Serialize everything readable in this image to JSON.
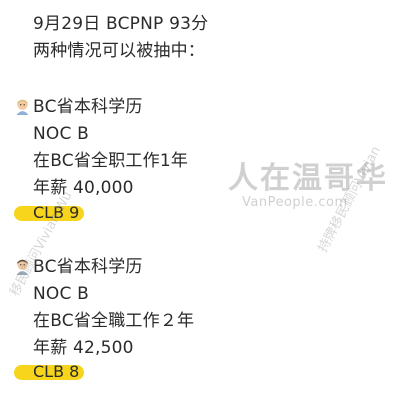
{
  "post": {
    "header_line1": "9月29日 BCPNP 93分",
    "header_line2": "两种情况可以被抽中：",
    "case1": {
      "line1": "BC省本科学历",
      "line2": "NOC B",
      "line3": "在BC省全职工作1年",
      "line4": "年薪 40,000",
      "clb": "CLB 9",
      "avatar_icon": "person-emoji-icon"
    },
    "case2": {
      "line1": "BC省本科学历",
      "line2": "NOC B",
      "line3": "在BC省全職工作２年",
      "line4": "年薪 42,500",
      "clb": "CLB 8",
      "avatar_icon": "person-emoji-icon"
    },
    "highlight_color": "#f7d51d"
  },
  "watermarks": {
    "logo_cn": "人在温哥华",
    "logo_en": "VanPeople.com",
    "author_right": "持牌移民顾问Vivian",
    "author_left": "移民顾问Vivian Wu"
  }
}
